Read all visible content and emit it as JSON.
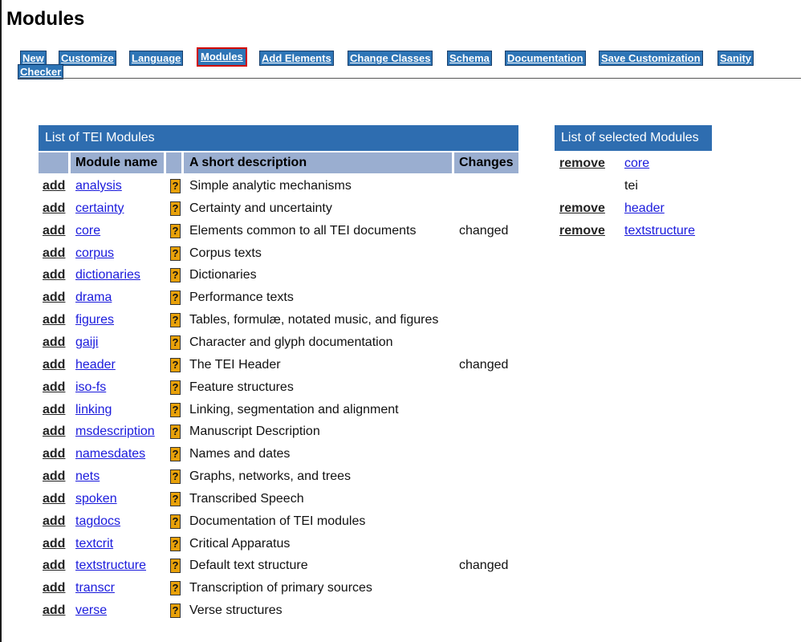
{
  "page": {
    "title": "Modules"
  },
  "nav": {
    "items": [
      {
        "label": "New"
      },
      {
        "label": "Customize"
      },
      {
        "label": "Language"
      },
      {
        "label": "Modules",
        "active": true
      },
      {
        "label": "Add Elements"
      },
      {
        "label": "Change Classes"
      },
      {
        "label": "Schema"
      },
      {
        "label": "Documentation"
      },
      {
        "label": "Save Customization"
      },
      {
        "label": "Sanity"
      },
      {
        "label": "Checker"
      }
    ]
  },
  "modules_panel": {
    "title": "List of TEI Modules",
    "headers": {
      "name": "Module name",
      "description": "A short description",
      "changes": "Changes"
    },
    "add_label": "add",
    "help_icon": "?",
    "rows": [
      {
        "name": "analysis",
        "description": "Simple analytic mechanisms",
        "changes": ""
      },
      {
        "name": "certainty",
        "description": "Certainty and uncertainty",
        "changes": ""
      },
      {
        "name": "core",
        "description": "Elements common to all TEI documents",
        "changes": "changed"
      },
      {
        "name": "corpus",
        "description": "Corpus texts",
        "changes": ""
      },
      {
        "name": "dictionaries",
        "description": "Dictionaries",
        "changes": ""
      },
      {
        "name": "drama",
        "description": "Performance texts",
        "changes": ""
      },
      {
        "name": "figures",
        "description": "Tables, formulæ, notated music, and figures",
        "changes": ""
      },
      {
        "name": "gaiji",
        "description": "Character and glyph documentation",
        "changes": ""
      },
      {
        "name": "header",
        "description": "The TEI Header",
        "changes": "changed"
      },
      {
        "name": "iso-fs",
        "description": "Feature structures",
        "changes": ""
      },
      {
        "name": "linking",
        "description": "Linking, segmentation and alignment",
        "changes": ""
      },
      {
        "name": "msdescription",
        "description": "Manuscript Description",
        "changes": ""
      },
      {
        "name": "namesdates",
        "description": "Names and dates",
        "changes": ""
      },
      {
        "name": "nets",
        "description": "Graphs, networks, and trees",
        "changes": ""
      },
      {
        "name": "spoken",
        "description": "Transcribed Speech",
        "changes": ""
      },
      {
        "name": "tagdocs",
        "description": "Documentation of TEI modules",
        "changes": ""
      },
      {
        "name": "textcrit",
        "description": "Critical Apparatus",
        "changes": ""
      },
      {
        "name": "textstructure",
        "description": "Default text structure",
        "changes": "changed"
      },
      {
        "name": "transcr",
        "description": "Transcription of primary sources",
        "changes": ""
      },
      {
        "name": "verse",
        "description": "Verse structures",
        "changes": ""
      }
    ]
  },
  "selected_panel": {
    "title": "List of selected Modules",
    "remove_label": "remove",
    "rows": [
      {
        "name": "core",
        "removable": true
      },
      {
        "name": "tei",
        "removable": false
      },
      {
        "name": "header",
        "removable": true
      },
      {
        "name": "textstructure",
        "removable": true
      }
    ]
  },
  "colors": {
    "nav_button_bg": "#2e75b6",
    "panel_title_bg": "#2e6db0",
    "table_header_bg": "#9aaed0",
    "link": "#1a1adc",
    "active_border": "#d00000",
    "help_icon_bg": "#e8a10a"
  }
}
